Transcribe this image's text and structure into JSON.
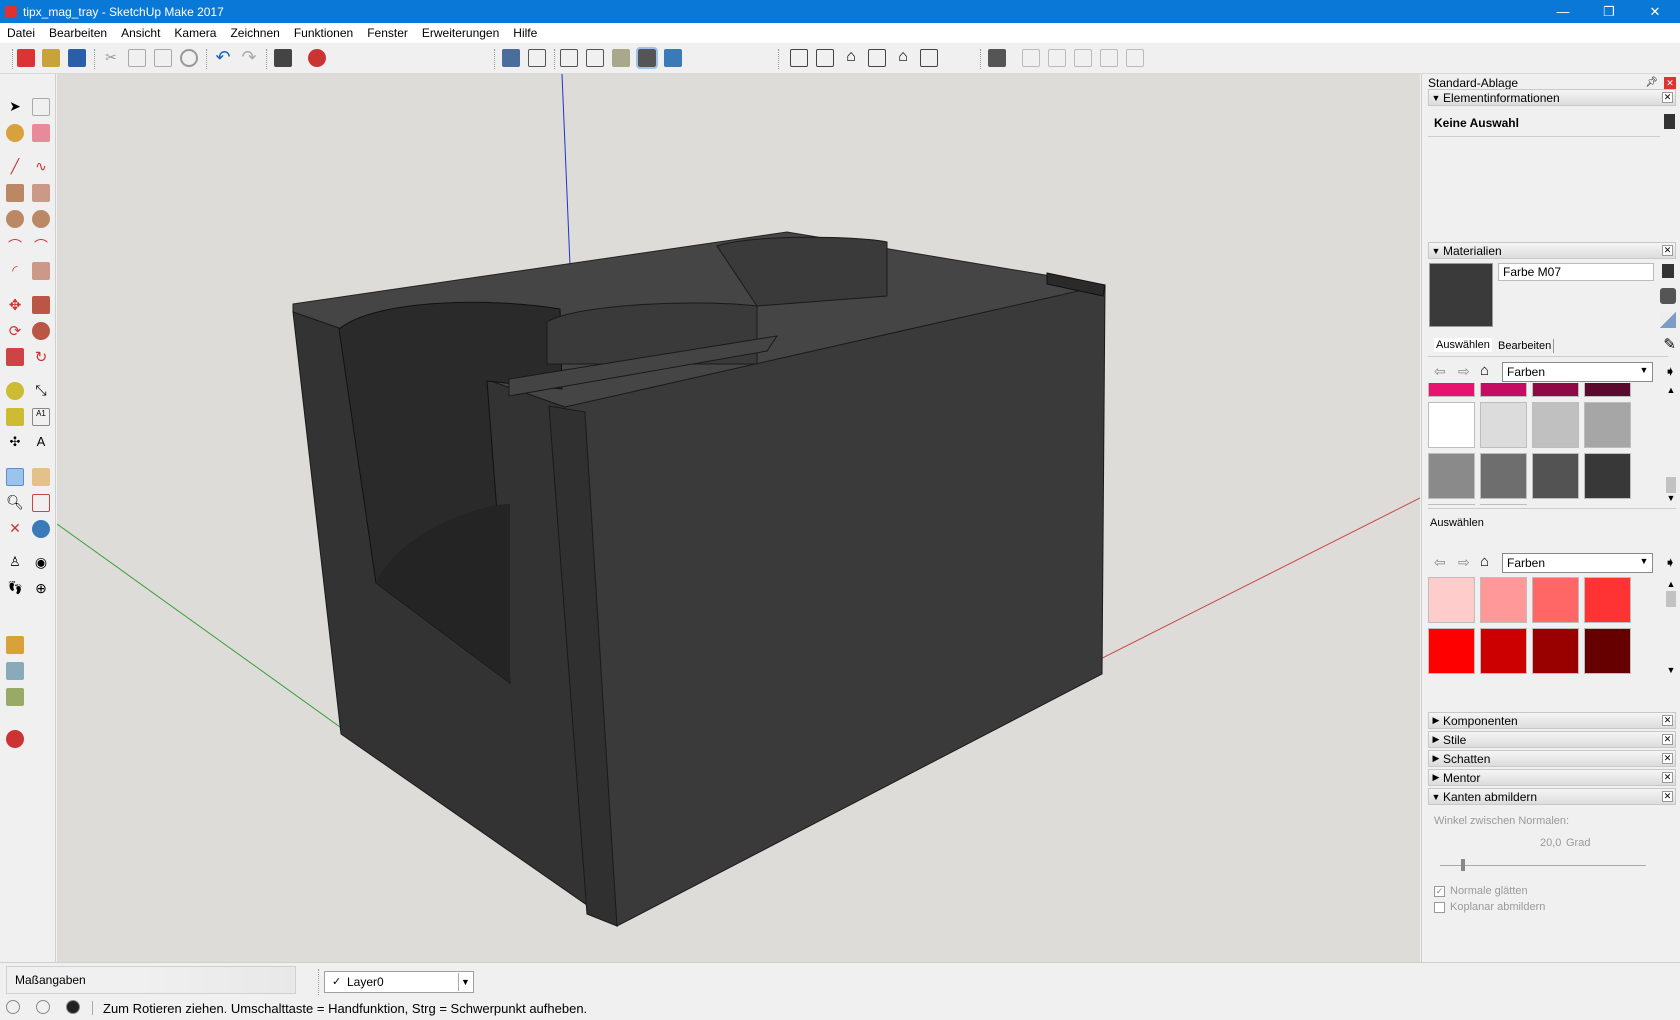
{
  "window": {
    "title": "tipx_mag_tray - SketchUp Make 2017",
    "minimize": "—",
    "maximize": "❐",
    "close": "✕"
  },
  "menu": [
    "Datei",
    "Bearbeiten",
    "Ansicht",
    "Kamera",
    "Zeichnen",
    "Funktionen",
    "Fenster",
    "Erweiterungen",
    "Hilfe"
  ],
  "tray": {
    "title": "Standard-Ablage",
    "entity_info": {
      "header": "Elementinformationen",
      "selection": "Keine Auswahl"
    },
    "materials": {
      "header": "Materialien",
      "name": "Farbe M07",
      "preview_color": "#3a3a3a",
      "tab_select": "Auswählen",
      "tab_edit": "Bearbeiten",
      "library": "Farben",
      "swatches_top_partial": [
        "#e8136f",
        "#c40d62",
        "#8e0a45",
        "#5c0a2c"
      ],
      "swatches_greys": [
        "#ffffff",
        "#dcdcdc",
        "#c0c0c0",
        "#a6a6a6",
        "#8a8a8a",
        "#6e6e6e",
        "#535353",
        "#383838"
      ],
      "swatches_bottom_partial": [
        "#1a1a1a",
        "#000000"
      ],
      "second_label": "Auswählen",
      "second_library": "Farben",
      "swatches_reds": [
        "#ffcccc",
        "#ff9999",
        "#ff6666",
        "#ff3333",
        "#ff0000",
        "#cc0000",
        "#990000",
        "#660000"
      ]
    },
    "panels": [
      "Komponenten",
      "Stile",
      "Schatten",
      "Mentor"
    ],
    "soften": {
      "header": "Kanten abmildern",
      "angle_label": "Winkel zwischen Normalen:",
      "angle_value": "20,0",
      "angle_unit": "Grad",
      "slider_value_deg": 20,
      "smooth_normals": "Normale glätten",
      "smooth_checked": true,
      "soften_coplanar": "Koplanar abmildern",
      "coplanar_checked": false
    }
  },
  "status": {
    "measurements_label": "Maßangaben",
    "layer": "Layer0",
    "hint": "Zum Rotieren ziehen. Umschalttaste = Handfunktion, Strg = Schwerpunkt aufheben."
  },
  "colors": {
    "titlebar": "#0a78d7",
    "model": "#3b3b3b",
    "viewport_bg": "#dedcd8"
  }
}
